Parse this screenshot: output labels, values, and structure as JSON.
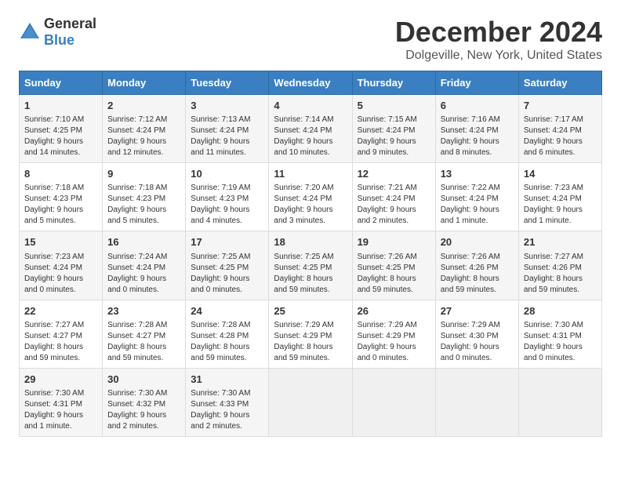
{
  "logo": {
    "text_general": "General",
    "text_blue": "Blue"
  },
  "header": {
    "title": "December 2024",
    "subtitle": "Dolgeville, New York, United States"
  },
  "days_of_week": [
    "Sunday",
    "Monday",
    "Tuesday",
    "Wednesday",
    "Thursday",
    "Friday",
    "Saturday"
  ],
  "weeks": [
    [
      {
        "day": 1,
        "sunrise": "7:10 AM",
        "sunset": "4:25 PM",
        "daylight": "9 hours and 14 minutes."
      },
      {
        "day": 2,
        "sunrise": "7:12 AM",
        "sunset": "4:24 PM",
        "daylight": "9 hours and 12 minutes."
      },
      {
        "day": 3,
        "sunrise": "7:13 AM",
        "sunset": "4:24 PM",
        "daylight": "9 hours and 11 minutes."
      },
      {
        "day": 4,
        "sunrise": "7:14 AM",
        "sunset": "4:24 PM",
        "daylight": "9 hours and 10 minutes."
      },
      {
        "day": 5,
        "sunrise": "7:15 AM",
        "sunset": "4:24 PM",
        "daylight": "9 hours and 9 minutes."
      },
      {
        "day": 6,
        "sunrise": "7:16 AM",
        "sunset": "4:24 PM",
        "daylight": "9 hours and 8 minutes."
      },
      {
        "day": 7,
        "sunrise": "7:17 AM",
        "sunset": "4:24 PM",
        "daylight": "9 hours and 6 minutes."
      }
    ],
    [
      {
        "day": 8,
        "sunrise": "7:18 AM",
        "sunset": "4:23 PM",
        "daylight": "9 hours and 5 minutes."
      },
      {
        "day": 9,
        "sunrise": "7:18 AM",
        "sunset": "4:23 PM",
        "daylight": "9 hours and 5 minutes."
      },
      {
        "day": 10,
        "sunrise": "7:19 AM",
        "sunset": "4:23 PM",
        "daylight": "9 hours and 4 minutes."
      },
      {
        "day": 11,
        "sunrise": "7:20 AM",
        "sunset": "4:24 PM",
        "daylight": "9 hours and 3 minutes."
      },
      {
        "day": 12,
        "sunrise": "7:21 AM",
        "sunset": "4:24 PM",
        "daylight": "9 hours and 2 minutes."
      },
      {
        "day": 13,
        "sunrise": "7:22 AM",
        "sunset": "4:24 PM",
        "daylight": "9 hours and 1 minute."
      },
      {
        "day": 14,
        "sunrise": "7:23 AM",
        "sunset": "4:24 PM",
        "daylight": "9 hours and 1 minute."
      }
    ],
    [
      {
        "day": 15,
        "sunrise": "7:23 AM",
        "sunset": "4:24 PM",
        "daylight": "9 hours and 0 minutes."
      },
      {
        "day": 16,
        "sunrise": "7:24 AM",
        "sunset": "4:24 PM",
        "daylight": "9 hours and 0 minutes."
      },
      {
        "day": 17,
        "sunrise": "7:25 AM",
        "sunset": "4:25 PM",
        "daylight": "9 hours and 0 minutes."
      },
      {
        "day": 18,
        "sunrise": "7:25 AM",
        "sunset": "4:25 PM",
        "daylight": "8 hours and 59 minutes."
      },
      {
        "day": 19,
        "sunrise": "7:26 AM",
        "sunset": "4:25 PM",
        "daylight": "8 hours and 59 minutes."
      },
      {
        "day": 20,
        "sunrise": "7:26 AM",
        "sunset": "4:26 PM",
        "daylight": "8 hours and 59 minutes."
      },
      {
        "day": 21,
        "sunrise": "7:27 AM",
        "sunset": "4:26 PM",
        "daylight": "8 hours and 59 minutes."
      }
    ],
    [
      {
        "day": 22,
        "sunrise": "7:27 AM",
        "sunset": "4:27 PM",
        "daylight": "8 hours and 59 minutes."
      },
      {
        "day": 23,
        "sunrise": "7:28 AM",
        "sunset": "4:27 PM",
        "daylight": "8 hours and 59 minutes."
      },
      {
        "day": 24,
        "sunrise": "7:28 AM",
        "sunset": "4:28 PM",
        "daylight": "8 hours and 59 minutes."
      },
      {
        "day": 25,
        "sunrise": "7:29 AM",
        "sunset": "4:29 PM",
        "daylight": "8 hours and 59 minutes."
      },
      {
        "day": 26,
        "sunrise": "7:29 AM",
        "sunset": "4:29 PM",
        "daylight": "9 hours and 0 minutes."
      },
      {
        "day": 27,
        "sunrise": "7:29 AM",
        "sunset": "4:30 PM",
        "daylight": "9 hours and 0 minutes."
      },
      {
        "day": 28,
        "sunrise": "7:30 AM",
        "sunset": "4:31 PM",
        "daylight": "9 hours and 0 minutes."
      }
    ],
    [
      {
        "day": 29,
        "sunrise": "7:30 AM",
        "sunset": "4:31 PM",
        "daylight": "9 hours and 1 minute."
      },
      {
        "day": 30,
        "sunrise": "7:30 AM",
        "sunset": "4:32 PM",
        "daylight": "9 hours and 2 minutes."
      },
      {
        "day": 31,
        "sunrise": "7:30 AM",
        "sunset": "4:33 PM",
        "daylight": "9 hours and 2 minutes."
      },
      null,
      null,
      null,
      null
    ]
  ]
}
